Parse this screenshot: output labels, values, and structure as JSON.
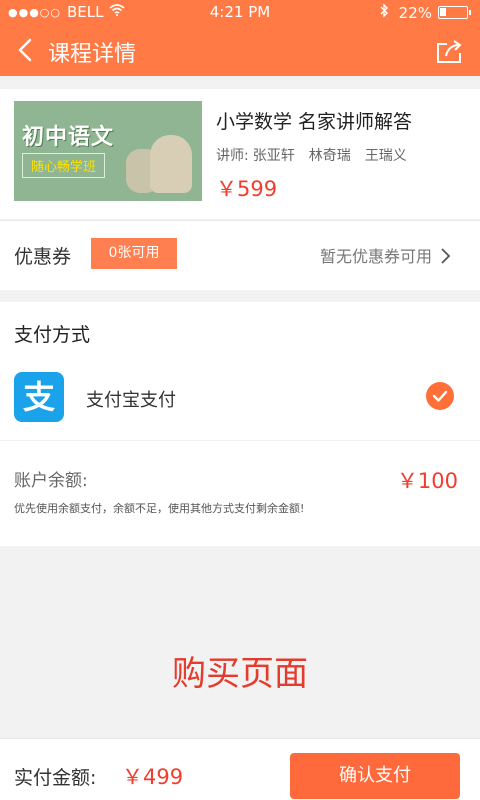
{
  "status_bar": {
    "signal": "●●●○○",
    "carrier": "BELL",
    "time": "4:21 PM",
    "battery_text": "22%",
    "battery_level": 0.22
  },
  "nav": {
    "title": "课程详情"
  },
  "course": {
    "thumb_title": "初中语文",
    "thumb_subtitle": "随心畅学班",
    "title": "小学数学 名家讲师解答",
    "teacher_label": "讲师:",
    "teachers": [
      "张亚轩",
      "林奇瑞",
      "王瑞义"
    ],
    "price": "￥599"
  },
  "coupon": {
    "label": "优惠券",
    "badge": "0张可用",
    "status": "暂无优惠券可用"
  },
  "payment": {
    "heading": "支付方式",
    "alipay_glyph": "支",
    "alipay_label": "支付宝支付",
    "balance_label": "账户余额:",
    "balance_value": "￥100",
    "note": "优先使用余额支付，余额不足，使用其他方式支付剩余金额!"
  },
  "watermark": "购买页面",
  "footer": {
    "total_label": "实付金额:",
    "total_value": "￥499",
    "confirm_label": "确认支付"
  },
  "colors": {
    "brand": "#ff7a45",
    "price_red": "#f23c2d",
    "alipay_blue": "#1aa3eb"
  },
  "icons": [
    "back-icon",
    "share-icon",
    "chevron-right-icon",
    "check-icon",
    "alipay-icon",
    "wifi-icon",
    "bluetooth-icon",
    "battery-icon"
  ]
}
